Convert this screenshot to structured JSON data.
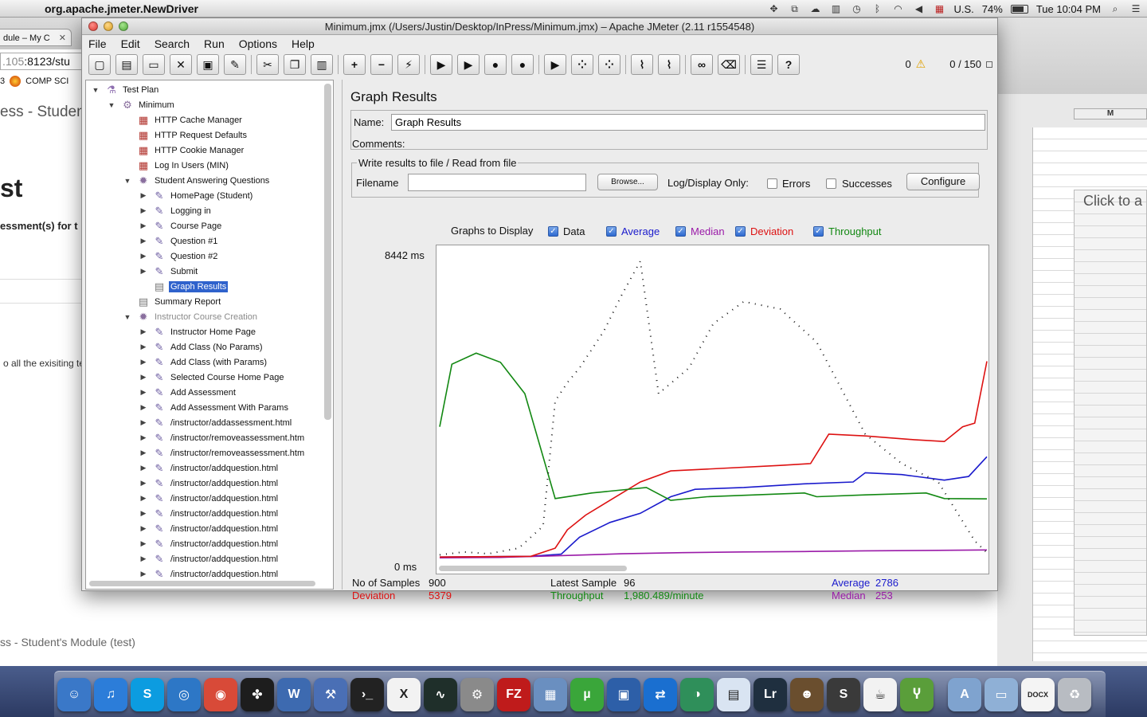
{
  "menubar": {
    "app_name": "org.apache.jmeter.NewDriver",
    "input_source": "U.S.",
    "battery": "74%",
    "clock": "Tue 10:04 PM"
  },
  "background": {
    "browser_tab": "dule – My C",
    "url_dim": ".105",
    "url_rest": ":8123/stu",
    "bookmark_num": "3",
    "bookmark_label": "COMP SCI",
    "heading1": "ess - Student",
    "heading2": "st",
    "heading3": "essment(s) for t",
    "text1": "o all the exisiting tes",
    "footer": "ss - Student's Module (test)",
    "sheet_col": "M",
    "sheet_click": "Click to a"
  },
  "window": {
    "title": "Minimum.jmx (/Users/Justin/Desktop/InPress/Minimum.jmx) – Apache JMeter (2.11 r1554548)",
    "menus": [
      "File",
      "Edit",
      "Search",
      "Run",
      "Options",
      "Help"
    ],
    "status_errors": "0",
    "status_threads": "0 / 150"
  },
  "toolbar": [
    {
      "name": "new-button",
      "icon": "new-file-icon",
      "glyph": "▢"
    },
    {
      "name": "templates-button",
      "icon": "templates-icon",
      "glyph": "▤"
    },
    {
      "name": "open-button",
      "icon": "folder-open-icon",
      "glyph": "▭"
    },
    {
      "name": "close-button",
      "icon": "close-file-icon",
      "glyph": "✕"
    },
    {
      "name": "save-button",
      "icon": "save-icon",
      "glyph": "▣"
    },
    {
      "name": "save-as-button",
      "icon": "save-as-icon",
      "glyph": "✎"
    },
    {
      "name": "sep"
    },
    {
      "name": "cut-button",
      "icon": "scissors-icon",
      "glyph": "✂"
    },
    {
      "name": "copy-button",
      "icon": "copy-icon",
      "glyph": "❐"
    },
    {
      "name": "paste-button",
      "icon": "paste-icon",
      "glyph": "▥"
    },
    {
      "name": "sep"
    },
    {
      "name": "expand-button",
      "icon": "plus-icon",
      "glyph": "+"
    },
    {
      "name": "collapse-button",
      "icon": "minus-icon",
      "glyph": "−"
    },
    {
      "name": "toggle-button",
      "icon": "toggle-icon",
      "glyph": "⚡"
    },
    {
      "name": "sep"
    },
    {
      "name": "start-button",
      "icon": "play-icon",
      "glyph": "▶"
    },
    {
      "name": "start-no-pause-button",
      "icon": "play-no-timer-icon",
      "glyph": "▶"
    },
    {
      "name": "stop-button",
      "icon": "stop-icon",
      "glyph": "●"
    },
    {
      "name": "shutdown-button",
      "icon": "shutdown-icon",
      "glyph": "●"
    },
    {
      "name": "sep"
    },
    {
      "name": "remote-start-button",
      "icon": "remote-play-icon",
      "glyph": "▶"
    },
    {
      "name": "remote-stop-button",
      "icon": "remote-stop-icon",
      "glyph": "⁘"
    },
    {
      "name": "remote-shutdown-button",
      "icon": "remote-shutdown-icon",
      "glyph": "⁘"
    },
    {
      "name": "sep"
    },
    {
      "name": "clear-button",
      "icon": "broom-icon",
      "glyph": "⌇"
    },
    {
      "name": "clear-all-button",
      "icon": "broom-all-icon",
      "glyph": "⌇"
    },
    {
      "name": "sep"
    },
    {
      "name": "search-button",
      "icon": "binoculars-icon",
      "glyph": "∞"
    },
    {
      "name": "reset-search-button",
      "icon": "eraser-icon",
      "glyph": "⌫"
    },
    {
      "name": "sep"
    },
    {
      "name": "function-helper-button",
      "icon": "list-icon",
      "glyph": "☰"
    },
    {
      "name": "help-button",
      "icon": "help-icon",
      "glyph": "?"
    }
  ],
  "tree": [
    {
      "label": "Test Plan",
      "level": 0,
      "toggle": "▼",
      "icon": "test-plan-icon",
      "glyph": "⚗",
      "kind": "plan"
    },
    {
      "label": "Minimum",
      "level": 1,
      "toggle": "▼",
      "icon": "thread-group-icon",
      "glyph": "⚙",
      "kind": "grp"
    },
    {
      "label": "HTTP Cache Manager",
      "level": 2,
      "toggle": "",
      "icon": "config-element-icon",
      "glyph": "▦",
      "kind": "cfg"
    },
    {
      "label": "HTTP Request Defaults",
      "level": 2,
      "toggle": "",
      "icon": "config-element-icon",
      "glyph": "▦",
      "kind": "cfg"
    },
    {
      "label": "HTTP Cookie Manager",
      "level": 2,
      "toggle": "",
      "icon": "config-element-icon",
      "glyph": "▦",
      "kind": "cfg"
    },
    {
      "label": "Log In Users (MIN)",
      "level": 2,
      "toggle": "",
      "icon": "config-element-icon",
      "glyph": "▦",
      "kind": "cfg"
    },
    {
      "label": "Student Answering Questions",
      "level": 2,
      "toggle": "▼",
      "icon": "controller-icon",
      "glyph": "✹",
      "kind": "grp"
    },
    {
      "label": "HomePage (Student)",
      "level": 3,
      "toggle": "▶",
      "icon": "sampler-icon",
      "glyph": "✎",
      "kind": "smp"
    },
    {
      "label": "Logging in",
      "level": 3,
      "toggle": "▶",
      "icon": "sampler-icon",
      "glyph": "✎",
      "kind": "smp"
    },
    {
      "label": "Course Page",
      "level": 3,
      "toggle": "▶",
      "icon": "sampler-icon",
      "glyph": "✎",
      "kind": "smp"
    },
    {
      "label": "Question #1",
      "level": 3,
      "toggle": "▶",
      "icon": "sampler-icon",
      "glyph": "✎",
      "kind": "smp"
    },
    {
      "label": "Question #2",
      "level": 3,
      "toggle": "▶",
      "icon": "sampler-icon",
      "glyph": "✎",
      "kind": "smp"
    },
    {
      "label": "Submit",
      "level": 3,
      "toggle": "▶",
      "icon": "sampler-icon",
      "glyph": "✎",
      "kind": "smp"
    },
    {
      "label": "Graph Results",
      "level": 3,
      "toggle": "",
      "icon": "listener-icon",
      "glyph": "▤",
      "kind": "lst",
      "selected": true
    },
    {
      "label": "Summary Report",
      "level": 2,
      "toggle": "",
      "icon": "listener-icon",
      "glyph": "▤",
      "kind": "lst"
    },
    {
      "label": "Instructor Course Creation",
      "level": 2,
      "toggle": "▼",
      "icon": "controller-icon",
      "glyph": "✹",
      "kind": "grp",
      "disabled": true
    },
    {
      "label": "Instructor Home Page",
      "level": 3,
      "toggle": "▶",
      "icon": "sampler-icon",
      "glyph": "✎",
      "kind": "smp"
    },
    {
      "label": "Add Class (No Params)",
      "level": 3,
      "toggle": "▶",
      "icon": "sampler-icon",
      "glyph": "✎",
      "kind": "smp"
    },
    {
      "label": "Add Class (with Params)",
      "level": 3,
      "toggle": "▶",
      "icon": "sampler-icon",
      "glyph": "✎",
      "kind": "smp"
    },
    {
      "label": "Selected Course Home Page",
      "level": 3,
      "toggle": "▶",
      "icon": "sampler-icon",
      "glyph": "✎",
      "kind": "smp"
    },
    {
      "label": "Add Assessment",
      "level": 3,
      "toggle": "▶",
      "icon": "sampler-icon",
      "glyph": "✎",
      "kind": "smp"
    },
    {
      "label": "Add Assessment With Params",
      "level": 3,
      "toggle": "▶",
      "icon": "sampler-icon",
      "glyph": "✎",
      "kind": "smp"
    },
    {
      "label": "/instructor/addassessment.html",
      "level": 3,
      "toggle": "▶",
      "icon": "sampler-icon",
      "glyph": "✎",
      "kind": "smp"
    },
    {
      "label": "/instructor/removeassessment.htm",
      "level": 3,
      "toggle": "▶",
      "icon": "sampler-icon",
      "glyph": "✎",
      "kind": "smp"
    },
    {
      "label": "/instructor/removeassessment.htm",
      "level": 3,
      "toggle": "▶",
      "icon": "sampler-icon",
      "glyph": "✎",
      "kind": "smp"
    },
    {
      "label": "/instructor/addquestion.html",
      "level": 3,
      "toggle": "▶",
      "icon": "sampler-icon",
      "glyph": "✎",
      "kind": "smp"
    },
    {
      "label": "/instructor/addquestion.html",
      "level": 3,
      "toggle": "▶",
      "icon": "sampler-icon",
      "glyph": "✎",
      "kind": "smp"
    },
    {
      "label": "/instructor/addquestion.html",
      "level": 3,
      "toggle": "▶",
      "icon": "sampler-icon",
      "glyph": "✎",
      "kind": "smp"
    },
    {
      "label": "/instructor/addquestion.html",
      "level": 3,
      "toggle": "▶",
      "icon": "sampler-icon",
      "glyph": "✎",
      "kind": "smp"
    },
    {
      "label": "/instructor/addquestion.html",
      "level": 3,
      "toggle": "▶",
      "icon": "sampler-icon",
      "glyph": "✎",
      "kind": "smp"
    },
    {
      "label": "/instructor/addquestion.html",
      "level": 3,
      "toggle": "▶",
      "icon": "sampler-icon",
      "glyph": "✎",
      "kind": "smp"
    },
    {
      "label": "/instructor/addquestion.html",
      "level": 3,
      "toggle": "▶",
      "icon": "sampler-icon",
      "glyph": "✎",
      "kind": "smp"
    },
    {
      "label": "/instructor/addquestion.html",
      "level": 3,
      "toggle": "▶",
      "icon": "sampler-icon",
      "glyph": "✎",
      "kind": "smp"
    }
  ],
  "panel": {
    "title": "Graph Results",
    "name_label": "Name:",
    "name_value": "Graph Results",
    "comments_label": "Comments:",
    "file_legend": "Write results to file / Read from file",
    "filename_label": "Filename",
    "filename_value": "",
    "browse_label": "Browse...",
    "logonly_label": "Log/Display Only:",
    "errors_label": "Errors",
    "successes_label": "Successes",
    "configure_label": "Configure",
    "graphs_label": "Graphs to Display",
    "graph_checks": [
      {
        "label": "Data",
        "color": "#111111",
        "checked": true
      },
      {
        "label": "Average",
        "color": "#1a1acc",
        "checked": true
      },
      {
        "label": "Median",
        "color": "#9a1aa8",
        "checked": true
      },
      {
        "label": "Deviation",
        "color": "#dd1111",
        "checked": true
      },
      {
        "label": "Throughput",
        "color": "#128812",
        "checked": true
      }
    ],
    "y_max_label": "8442  ms",
    "y_min_label": "0  ms"
  },
  "stats": {
    "samples_label": "No of Samples",
    "samples_value": "900",
    "latest_label": "Latest Sample",
    "latest_value": "96",
    "average_label": "Average",
    "average_value": "2786",
    "deviation_label": "Deviation",
    "deviation_value": "5379",
    "throughput_label": "Throughput",
    "throughput_value": "1,980.489/minute",
    "median_label": "Median",
    "median_value": "253"
  },
  "colors": {
    "data": "#111111",
    "average": "#1a1acc",
    "median": "#9a1aa8",
    "deviation": "#dd1111",
    "throughput": "#128812",
    "selection": "#2f62cc"
  },
  "chart_data": {
    "type": "line",
    "y_unit": "ms",
    "ylim": [
      0,
      8442
    ],
    "x_samples": [
      0,
      900
    ],
    "grid": false,
    "series": [
      {
        "name": "Average",
        "color": "#1a1acc",
        "points": [
          [
            0,
            60
          ],
          [
            150,
            80
          ],
          [
            200,
            140
          ],
          [
            230,
            600
          ],
          [
            280,
            1000
          ],
          [
            330,
            1250
          ],
          [
            380,
            1700
          ],
          [
            420,
            1900
          ],
          [
            500,
            1950
          ],
          [
            600,
            2050
          ],
          [
            680,
            2100
          ],
          [
            700,
            2350
          ],
          [
            760,
            2300
          ],
          [
            830,
            2150
          ],
          [
            870,
            2250
          ],
          [
            900,
            2786
          ]
        ]
      },
      {
        "name": "Median",
        "color": "#9a1aa8",
        "points": [
          [
            0,
            40
          ],
          [
            100,
            50
          ],
          [
            200,
            100
          ],
          [
            300,
            150
          ],
          [
            400,
            180
          ],
          [
            500,
            200
          ],
          [
            600,
            210
          ],
          [
            700,
            230
          ],
          [
            800,
            240
          ],
          [
            900,
            253
          ]
        ]
      },
      {
        "name": "Deviation",
        "color": "#dd1111",
        "points": [
          [
            0,
            60
          ],
          [
            150,
            80
          ],
          [
            190,
            300
          ],
          [
            210,
            800
          ],
          [
            240,
            1200
          ],
          [
            280,
            1600
          ],
          [
            330,
            2100
          ],
          [
            380,
            2400
          ],
          [
            440,
            2450
          ],
          [
            560,
            2550
          ],
          [
            610,
            2600
          ],
          [
            640,
            3400
          ],
          [
            700,
            3350
          ],
          [
            780,
            3250
          ],
          [
            830,
            3200
          ],
          [
            860,
            3600
          ],
          [
            880,
            3700
          ],
          [
            900,
            5379
          ]
        ]
      },
      {
        "name": "Throughput",
        "color": "#128812",
        "points": [
          [
            0,
            3600
          ],
          [
            20,
            5300
          ],
          [
            60,
            5600
          ],
          [
            100,
            5350
          ],
          [
            140,
            4500
          ],
          [
            190,
            1650
          ],
          [
            250,
            1800
          ],
          [
            340,
            1950
          ],
          [
            380,
            1600
          ],
          [
            440,
            1700
          ],
          [
            600,
            1800
          ],
          [
            620,
            1700
          ],
          [
            700,
            1750
          ],
          [
            800,
            1800
          ],
          [
            830,
            1650
          ],
          [
            900,
            1640
          ]
        ]
      },
      {
        "name": "Data",
        "color": "#111111",
        "points": [
          [
            0,
            120
          ],
          [
            40,
            200
          ],
          [
            80,
            150
          ],
          [
            130,
            300
          ],
          [
            170,
            900
          ],
          [
            190,
            4300
          ],
          [
            210,
            4800
          ],
          [
            230,
            5200
          ],
          [
            270,
            6200
          ],
          [
            300,
            7200
          ],
          [
            330,
            8100
          ],
          [
            360,
            4500
          ],
          [
            410,
            5200
          ],
          [
            450,
            6400
          ],
          [
            500,
            7000
          ],
          [
            560,
            6800
          ],
          [
            620,
            5900
          ],
          [
            700,
            3400
          ],
          [
            760,
            2600
          ],
          [
            820,
            2100
          ],
          [
            880,
            500
          ],
          [
            900,
            180
          ]
        ]
      }
    ]
  },
  "dock": [
    {
      "name": "finder",
      "label": "☺",
      "color": "#3a78c8"
    },
    {
      "name": "itunes",
      "label": "♫",
      "color": "#2c7dd9"
    },
    {
      "name": "skype",
      "label": "S",
      "color": "#0c9ce0"
    },
    {
      "name": "safari",
      "label": "◎",
      "color": "#2d77c6"
    },
    {
      "name": "chrome",
      "label": "◉",
      "color": "#d84a38"
    },
    {
      "name": "razer",
      "label": "✤",
      "color": "#1d1d1d"
    },
    {
      "name": "word-editor",
      "label": "W",
      "color": "#3d6ab0"
    },
    {
      "name": "xcode",
      "label": "⚒",
      "color": "#4a6fb5"
    },
    {
      "name": "terminal",
      "label": "›_",
      "color": "#222222"
    },
    {
      "name": "x11",
      "label": "X",
      "color": "#f2f2f2"
    },
    {
      "name": "activity-monitor",
      "label": "∿",
      "color": "#1f2f2a"
    },
    {
      "name": "system-prefs",
      "label": "⚙",
      "color": "#8a8a8a"
    },
    {
      "name": "filezilla",
      "label": "FZ",
      "color": "#bf1b1b"
    },
    {
      "name": "preview",
      "label": "▦",
      "color": "#6a8fc0"
    },
    {
      "name": "utorrent",
      "label": "µ",
      "color": "#3aa63a"
    },
    {
      "name": "virtualbox",
      "label": "▣",
      "color": "#2d5fa8"
    },
    {
      "name": "teamviewer",
      "label": "⇄",
      "color": "#1a6fd0"
    },
    {
      "name": "network",
      "label": "◑",
      "color": "#2f8f5a"
    },
    {
      "name": "calendar",
      "label": "▤",
      "color": "#d9e4f2"
    },
    {
      "name": "lightroom",
      "label": "Lr",
      "color": "#1f2f3f"
    },
    {
      "name": "github",
      "label": "☻",
      "color": "#6a4e2e"
    },
    {
      "name": "sublime",
      "label": "S",
      "color": "#3a3a3a"
    },
    {
      "name": "java",
      "label": "☕",
      "color": "#f2f2f2"
    },
    {
      "name": "sourcetree",
      "label": "Ⴤ",
      "color": "#5a9e3a"
    },
    {
      "name": "applications-folder",
      "label": "A",
      "color": "#7fa3cf"
    },
    {
      "name": "documents-folder",
      "label": "▭",
      "color": "#8fb0d6"
    },
    {
      "name": "docx-file",
      "label": "DOCX",
      "color": "#f4f4f4"
    },
    {
      "name": "trash",
      "label": "♻",
      "color": "#b8bcc2"
    }
  ]
}
